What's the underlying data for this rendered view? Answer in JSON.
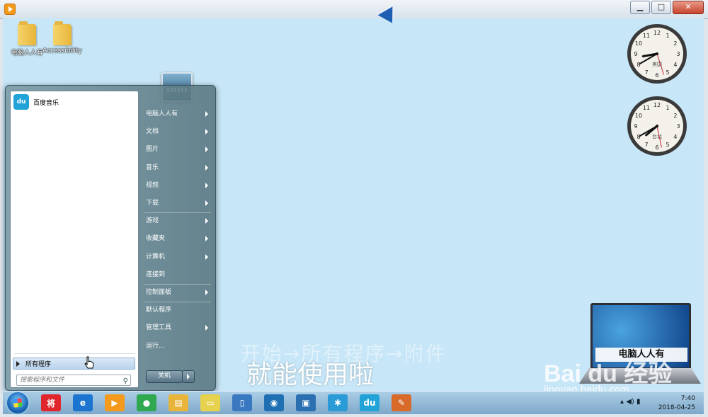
{
  "window": {
    "minimize": "▁",
    "maximize": "□",
    "close": "✕"
  },
  "desktop_icons": [
    {
      "label": "电脑人人有"
    },
    {
      "label": "Accessibility"
    }
  ],
  "clocks": [
    {
      "label": "美国",
      "hour": 8,
      "minute": 40,
      "second": 27
    },
    {
      "label": "台北",
      "hour": 7,
      "minute": 40,
      "second": 28
    }
  ],
  "start_menu": {
    "pinned": [
      {
        "label": "百度音乐",
        "icon": "baidu-music-icon"
      }
    ],
    "right_items": [
      {
        "label": "电脑人人有",
        "arrow": true
      },
      {
        "label": "文档",
        "arrow": true
      },
      {
        "label": "图片",
        "arrow": true
      },
      {
        "label": "音乐",
        "arrow": true
      },
      {
        "label": "视频",
        "arrow": true
      },
      {
        "label": "下载",
        "arrow": true
      },
      {
        "label": "游戏",
        "arrow": true
      },
      {
        "label": "收藏夹",
        "arrow": true
      },
      {
        "label": "计算机",
        "arrow": true
      },
      {
        "label": "连接到",
        "arrow": false
      },
      {
        "label": "控制面板",
        "arrow": true
      },
      {
        "label": "默认程序",
        "arrow": false
      },
      {
        "label": "管理工具",
        "arrow": true
      },
      {
        "label": "运行...",
        "arrow": false
      }
    ],
    "all_programs": "所有程序",
    "search_placeholder": "搜索程序和文件",
    "shutdown": "关机"
  },
  "overlay": {
    "faint_caption": "开始→所有程序→附件",
    "caption": "就能使用啦",
    "watermark_logo": "Bai du 经验",
    "watermark_url": "jingyan.baidu.com",
    "laptop_brand": "电脑人人有"
  },
  "taskbar": {
    "apps": [
      {
        "icon": "jiang-app-icon",
        "text": "将",
        "color": "#e0262b"
      },
      {
        "icon": "internet-explorer-icon",
        "text": "e",
        "color": "#1b75d0"
      },
      {
        "icon": "media-player-icon",
        "text": "▶",
        "color": "#f39a1d"
      },
      {
        "icon": "chrome-icon",
        "text": "●",
        "color": "#2fa84f"
      },
      {
        "icon": "file-explorer-icon",
        "text": "▤",
        "color": "#e8b53a"
      },
      {
        "icon": "notes-icon",
        "text": "▭",
        "color": "#e6d24d"
      },
      {
        "icon": "document-icon",
        "text": "▯",
        "color": "#3a78c2"
      },
      {
        "icon": "browser-icon",
        "text": "◉",
        "color": "#1f6fb3"
      },
      {
        "icon": "remote-desktop-icon",
        "text": "▣",
        "color": "#2a6fb0"
      },
      {
        "icon": "pinwheel-icon",
        "text": "✱",
        "color": "#2a9bd6"
      },
      {
        "icon": "baidu-music-icon",
        "text": "du",
        "color": "#21a3d8"
      },
      {
        "icon": "paint-icon",
        "text": "✎",
        "color": "#d86a2a"
      }
    ],
    "time": "7:40",
    "date": "2018-04-25",
    "tray_symbols": "▴  ◀)  ▮"
  }
}
